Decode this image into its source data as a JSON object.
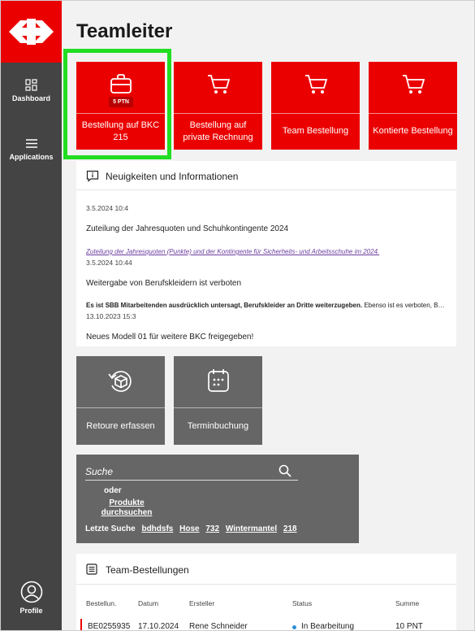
{
  "page": {
    "title": "Teamleiter"
  },
  "sidebar": {
    "items": [
      {
        "label": "Dashboard",
        "icon": "dashboard-icon"
      },
      {
        "label": "Applications",
        "icon": "menu-icon"
      }
    ],
    "profile": {
      "label": "Profile",
      "icon": "user-icon"
    }
  },
  "tiles": [
    {
      "label": "Bestellung auf BKC 215",
      "icon": "bag-icon",
      "badge": "5 PTN"
    },
    {
      "label": "Bestellung auf private Rechnung",
      "icon": "cart-icon"
    },
    {
      "label": "Team Bestellung",
      "icon": "cart-icon"
    },
    {
      "label": "Kontierte Bestellung",
      "icon": "cart-icon"
    }
  ],
  "news": {
    "title": "Neuigkeiten und Informationen",
    "icon": "info-icon",
    "items": [
      {
        "date": "3.5.2024   10:4",
        "headline": "Zuteilung der Jahresquoten und Schuhkontingente 2024",
        "link": "Zuteilung der Jahresquoten (Punkte) und der Kontingente für Sicherheits- und Arbeitsschuhe im 2024."
      },
      {
        "date": "3.5.2024   10:44",
        "headline": "Weitergabe von Berufskleidern ist verboten",
        "snippet_bold": "Es ist SBB Mitarbeitenden ausdrücklich untersagt, Berufskleider an Dritte weiterzugeben.",
        "snippet_rest": " Ebenso ist es verboten, Berufskleider zu verkaufen."
      },
      {
        "date": "13.10.2023   15:3",
        "headline": "Neues Modell 01 für weitere BKC freigegeben!"
      }
    ]
  },
  "actions": [
    {
      "label": "Retoure erfassen",
      "icon": "return-box-icon"
    },
    {
      "label": "Terminbuchung",
      "icon": "calendar-icon"
    }
  ],
  "search": {
    "placeholder": "Suche",
    "or": "oder",
    "browse": "Produkte durchsuchen",
    "recent_label": "Letzte Suche",
    "recent": [
      "bdhdsfs",
      "Hose",
      "732",
      "Wintermantel",
      "218"
    ]
  },
  "orders": {
    "title": "Team-Bestellungen",
    "icon": "list-icon",
    "columns": [
      "Bestellun.",
      "Datum",
      "Ersteller",
      "Status",
      "Summe"
    ],
    "rows": [
      [
        "BE0255935",
        "17.10.2024",
        "Rene Schneider",
        "In Bearbeitung",
        "10 PNT"
      ]
    ]
  },
  "colors": {
    "brand_red": "#eb0000",
    "sidebar": "#444444",
    "tile_gray": "#666666",
    "highlight": "#22dd22"
  }
}
